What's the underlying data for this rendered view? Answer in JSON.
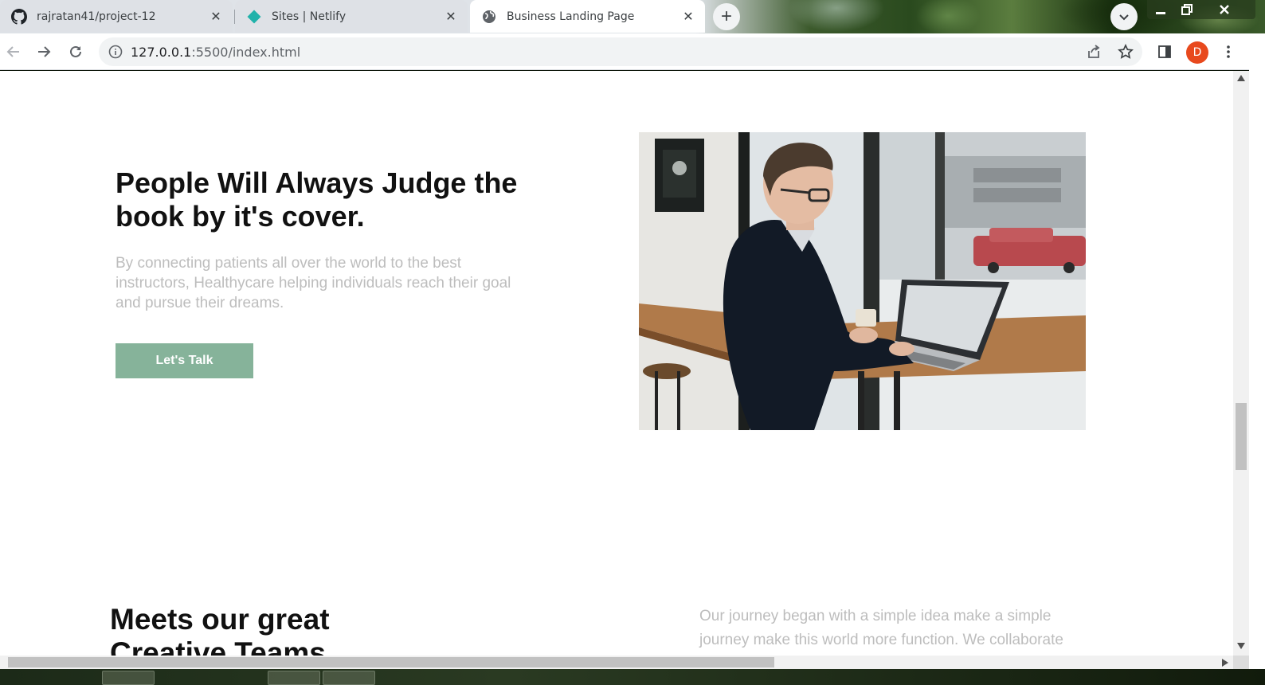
{
  "browser": {
    "tabs": [
      {
        "title": "rajratan41/project-12",
        "icon": "github-icon",
        "state": "inactive"
      },
      {
        "title": "Sites | Netlify",
        "icon": "netlify-icon",
        "state": "inactive"
      },
      {
        "title": "Business Landing Page",
        "icon": "globe-icon",
        "state": "active"
      }
    ],
    "close_glyph": "✕",
    "new_tab_glyph": "+",
    "address": {
      "host": "127.0.0.1",
      "rest": ":5500/index.html"
    },
    "profile_initial": "D",
    "colors": {
      "profile": "#e8491d",
      "netlify": "#20b2aa"
    }
  },
  "page": {
    "hero": {
      "title": "People Will Always Judge the book by it's cover.",
      "text": "By connecting patients all over the world to the best instructors, Healthycare helping individuals reach their goal and pursue their dreams.",
      "cta_label": "Let's Talk",
      "image": "man-working-on-laptop-photo"
    },
    "teams": {
      "title": "Meets our great Creative Teams",
      "text": "Our journey began with a simple idea make a simple journey make this world more function. We collaborate"
    },
    "colors": {
      "accent": "#86b39a",
      "muted_text": "#bdbdbd",
      "heading": "#111111"
    }
  }
}
